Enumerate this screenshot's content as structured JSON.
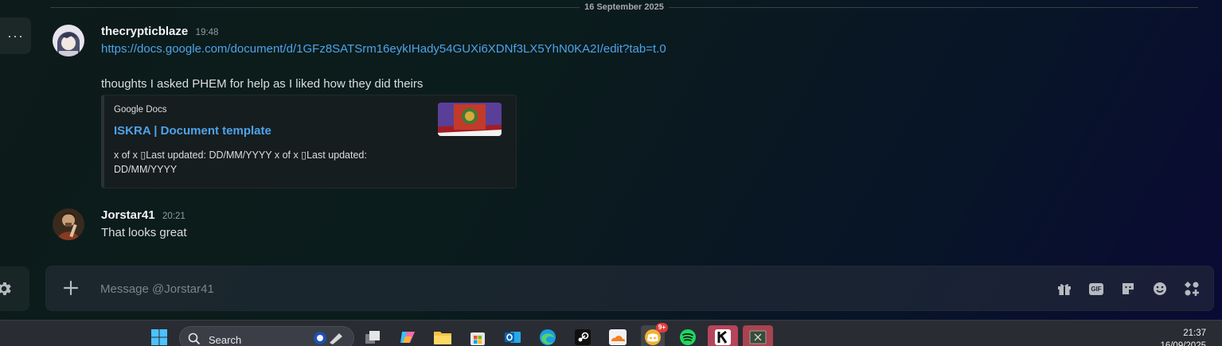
{
  "date_divider": "16 September 2025",
  "messages": [
    {
      "author": "thecrypticblaze",
      "time": "19:48",
      "link": "https://docs.google.com/document/d/1GFz8SATSrm16eykIHady54GUXi6XDNf3LX5YhN0KA2I/edit?tab=t.0",
      "text": "thoughts I asked PHEM for help as I liked how they did theirs",
      "embed": {
        "provider": "Google Docs",
        "title": "ISKRA | Document template",
        "description": "x of x ▯Last updated: DD/MM/YYYY x of x ▯Last updated: DD/MM/YYYY"
      }
    },
    {
      "author": "Jorstar41",
      "time": "20:21",
      "text": "That looks great"
    }
  ],
  "composer": {
    "placeholder": "Message @Jorstar41",
    "gif_label": "GIF"
  },
  "taskbar": {
    "search_label": "Search",
    "notification_badge": "9+",
    "clock_time": "21:37",
    "clock_date": "16/09/2025"
  },
  "colors": {
    "link": "#4fa3e9",
    "spotify": "#1ed760",
    "discord": "#5865f2",
    "badge": "#e23c3c"
  }
}
